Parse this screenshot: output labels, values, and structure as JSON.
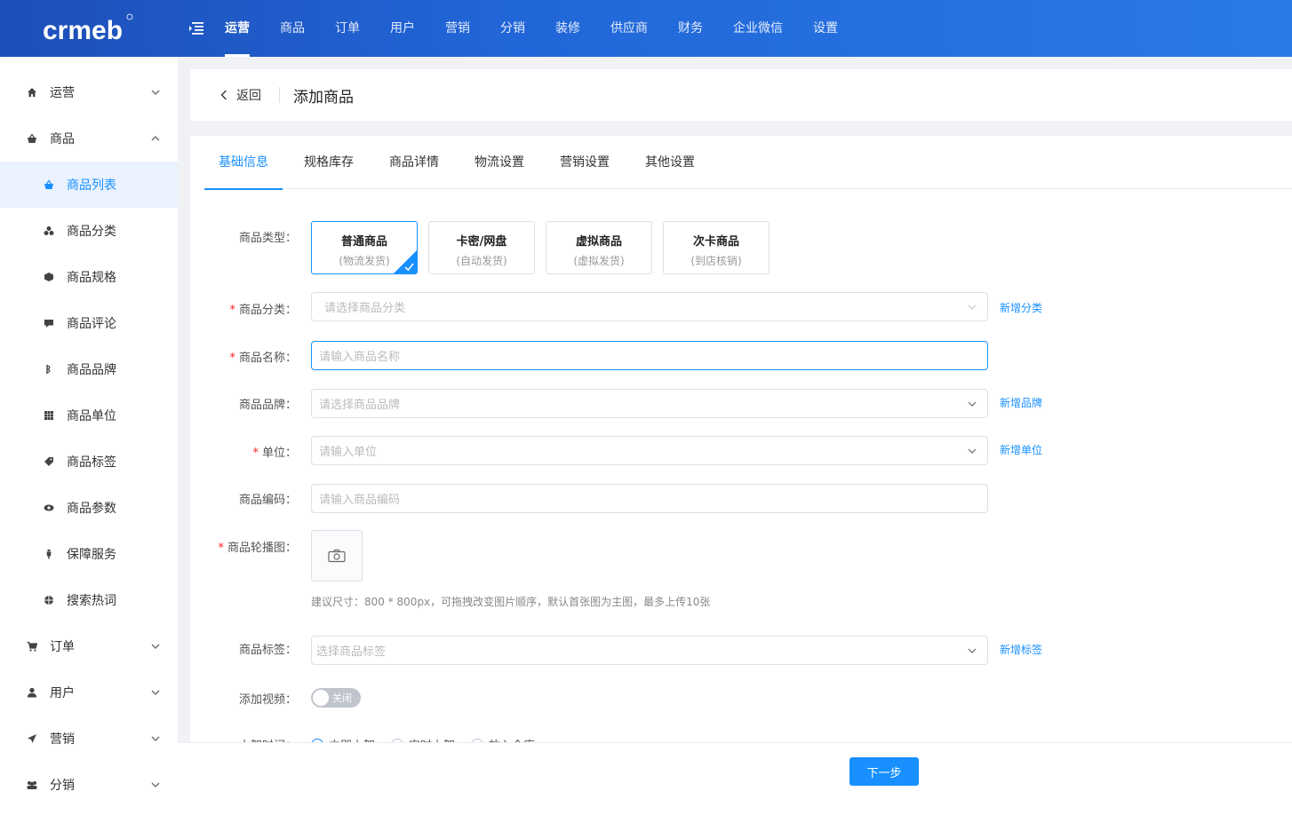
{
  "brand": {
    "logo_text": "crmeb",
    "accent": "#1890ff"
  },
  "topnav": {
    "items": [
      {
        "label": "运营",
        "active": true
      },
      {
        "label": "商品"
      },
      {
        "label": "订单"
      },
      {
        "label": "用户"
      },
      {
        "label": "营销"
      },
      {
        "label": "分销"
      },
      {
        "label": "装修"
      },
      {
        "label": "供应商"
      },
      {
        "label": "财务"
      },
      {
        "label": "企业微信"
      },
      {
        "label": "设置"
      }
    ]
  },
  "sidebar": {
    "operations": "运营",
    "product": "商品",
    "sub": [
      {
        "label": "商品列表",
        "icon": "basket-icon",
        "active": true
      },
      {
        "label": "商品分类",
        "icon": "category-icon"
      },
      {
        "label": "商品规格",
        "icon": "cube-icon"
      },
      {
        "label": "商品评论",
        "icon": "comment-icon"
      },
      {
        "label": "商品品牌",
        "icon": "brand-icon"
      },
      {
        "label": "商品单位",
        "icon": "grid-icon"
      },
      {
        "label": "商品标签",
        "icon": "tag-icon"
      },
      {
        "label": "商品参数",
        "icon": "eye-icon"
      },
      {
        "label": "保障服务",
        "icon": "shield-icon"
      },
      {
        "label": "搜索热词",
        "icon": "fire-icon"
      }
    ],
    "order": "订单",
    "user": "用户",
    "marketing": "营销",
    "distribution": "分销"
  },
  "header": {
    "back": "返回",
    "title": "添加商品"
  },
  "tabs": [
    "基础信息",
    "规格库存",
    "商品详情",
    "物流设置",
    "营销设置",
    "其他设置"
  ],
  "form": {
    "type_label": "商品类型：",
    "types": [
      {
        "title": "普通商品",
        "sub": "(物流发货)",
        "selected": true
      },
      {
        "title": "卡密/网盘",
        "sub": "(自动发货)"
      },
      {
        "title": "虚拟商品",
        "sub": "(虚拟发货)"
      },
      {
        "title": "次卡商品",
        "sub": "(到店核销)"
      }
    ],
    "category": {
      "label": "商品分类：",
      "placeholder": "请选择商品分类",
      "link": "新增分类"
    },
    "name": {
      "label": "商品名称：",
      "placeholder": "请输入商品名称"
    },
    "brand": {
      "label": "商品品牌：",
      "placeholder": "请选择商品品牌",
      "link": "新增品牌"
    },
    "unit": {
      "label": "单位：",
      "placeholder": "请输入单位",
      "link": "新增单位"
    },
    "code": {
      "label": "商品编码：",
      "placeholder": "请输入商品编码"
    },
    "carousel": {
      "label": "商品轮播图：",
      "hint": "建议尺寸：800 * 800px，可拖拽改变图片顺序，默认首张图为主图，最多上传10张"
    },
    "tags": {
      "label": "商品标签：",
      "placeholder": "选择商品标签",
      "link": "新增标签"
    },
    "video": {
      "label": "添加视频：",
      "switch_text": "关闭"
    },
    "shelf": {
      "label": "上架时间：",
      "options": [
        "立即上架",
        "定时上架",
        "放入仓库"
      ]
    }
  },
  "footer": {
    "next": "下一步"
  }
}
